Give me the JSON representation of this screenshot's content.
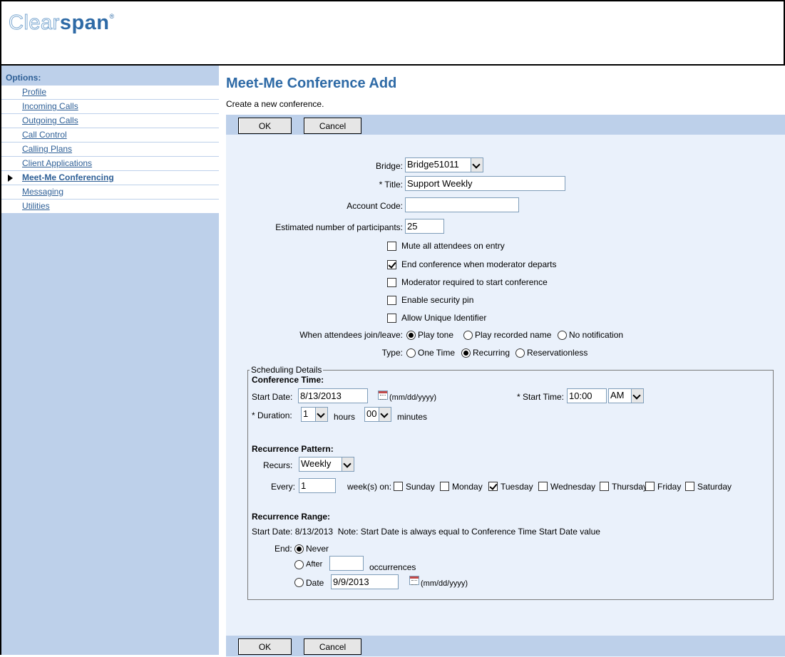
{
  "header": {
    "logo_part1": "Clear",
    "logo_part2": "span",
    "logo_mark": "®"
  },
  "sidebar": {
    "title": "Options:",
    "items": [
      {
        "label": "Profile"
      },
      {
        "label": "Incoming Calls"
      },
      {
        "label": "Outgoing Calls"
      },
      {
        "label": "Call Control"
      },
      {
        "label": "Calling Plans"
      },
      {
        "label": "Client Applications"
      },
      {
        "label": "Meet-Me Conferencing",
        "active": true
      },
      {
        "label": "Messaging"
      },
      {
        "label": "Utilities"
      }
    ]
  },
  "page": {
    "title": "Meet-Me Conference Add",
    "subtitle": "Create a new conference."
  },
  "buttons": {
    "ok": "OK",
    "cancel": "Cancel"
  },
  "form": {
    "bridge_label": "Bridge:",
    "bridge_value": "Bridge51011",
    "title_label": "* Title:",
    "title_value": "Support Weekly",
    "account_label": "Account Code:",
    "account_value": "",
    "participants_label": "Estimated number of participants:",
    "participants_value": "25",
    "options": [
      {
        "label": "Mute all attendees on entry",
        "checked": false
      },
      {
        "label": "End conference when moderator departs",
        "checked": true
      },
      {
        "label": "Moderator required to start conference",
        "checked": false
      },
      {
        "label": "Enable security pin",
        "checked": false
      },
      {
        "label": "Allow Unique Identifier",
        "checked": false
      }
    ],
    "join_label": "When attendees join/leave:",
    "join_options": [
      "Play tone",
      "Play recorded name",
      "No notification"
    ],
    "join_selected": "Play tone",
    "type_label": "Type:",
    "type_options": [
      "One Time",
      "Recurring",
      "Reservationless"
    ],
    "type_selected": "Recurring"
  },
  "scheduling": {
    "legend": "Scheduling Details",
    "conf_time_heading": "Conference Time:",
    "start_date_label": "Start Date:",
    "start_date_value": "8/13/2013",
    "date_format": "(mm/dd/yyyy)",
    "start_time_label": "* Start Time:",
    "start_time_value": "10:00",
    "ampm_value": "AM",
    "duration_label": "* Duration:",
    "duration_hours": "1",
    "hours_label": "hours",
    "duration_minutes": "00",
    "minutes_label": "minutes",
    "recurrence_heading": "Recurrence Pattern:",
    "recurs_label": "Recurs:",
    "recurs_value": "Weekly",
    "every_label": "Every:",
    "every_value": "1",
    "weeks_on_label": "week(s) on:",
    "days": [
      {
        "label": "Sunday",
        "checked": false
      },
      {
        "label": "Monday",
        "checked": false
      },
      {
        "label": "Tuesday",
        "checked": true
      },
      {
        "label": "Wednesday",
        "checked": false
      },
      {
        "label": "Thursday",
        "checked": false
      },
      {
        "label": "Friday",
        "checked": false
      },
      {
        "label": "Saturday",
        "checked": false
      }
    ],
    "range_heading": "Recurrence Range:",
    "range_note": "Start Date: 8/13/2013  Note: Start Date is always equal to Conference Time Start Date value",
    "end_label": "End:",
    "end_never": "Never",
    "end_after": "After",
    "after_value": "",
    "occurrences_label": "occurrences",
    "end_date": "Date",
    "end_date_value": "9/9/2013",
    "end_selected": "Never"
  }
}
